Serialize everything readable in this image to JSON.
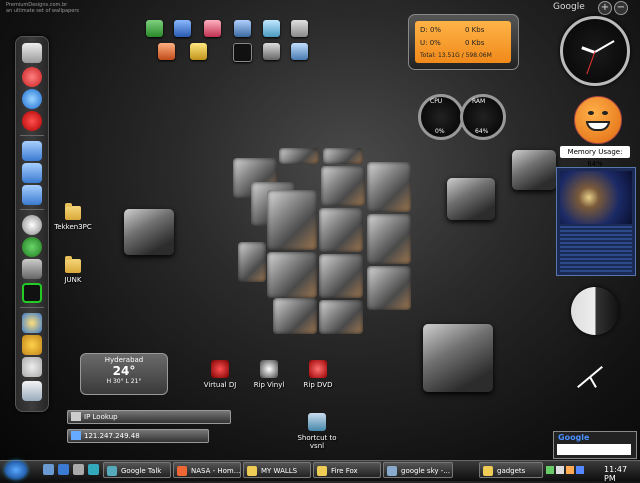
{
  "topleft_text": [
    "PremiumDesigns.com.br",
    "an ultimate set of wallpapers"
  ],
  "desktop_icons": [
    {
      "label": "Tekken3PC"
    },
    {
      "label": "JUNK"
    },
    {
      "label": "Virtual DJ"
    },
    {
      "label": "Rip Vinyl"
    },
    {
      "label": "Rip DVD"
    },
    {
      "label": "Shortcut to vsnl"
    }
  ],
  "net_meter": {
    "down": "D: 0%",
    "down_rate": "0 Kbs",
    "up": "U: 0%",
    "up_rate": "0 Kbs",
    "total": "Total: 13.51G / 598.06M"
  },
  "sidebar": {
    "google_label": "Google",
    "add_button": "+",
    "back_button": "−"
  },
  "meters": {
    "cpu_label": "CPU",
    "ram_label": "RAM",
    "cpu_value": "0%",
    "ram_value": "64%"
  },
  "memory": {
    "label": "Memory Usage: 64%"
  },
  "weather": {
    "city": "Hyderabad",
    "temp": "24°",
    "range": "H 30° L 21°"
  },
  "ip_lookup": {
    "label": "IP Lookup",
    "value": "121.247.249.48"
  },
  "google_search": {
    "logo": "Google"
  },
  "taskbar": {
    "items": [
      {
        "label": "Google Talk"
      },
      {
        "label": "NASA - Hom..."
      },
      {
        "label": "MY WALLS"
      },
      {
        "label": "Fire Fox"
      },
      {
        "label": "google sky -..."
      },
      {
        "label": "gadgets"
      }
    ],
    "time": "11:47 PM"
  },
  "colors": {
    "accent": "#f08a1a",
    "start": "#2a78d8"
  }
}
